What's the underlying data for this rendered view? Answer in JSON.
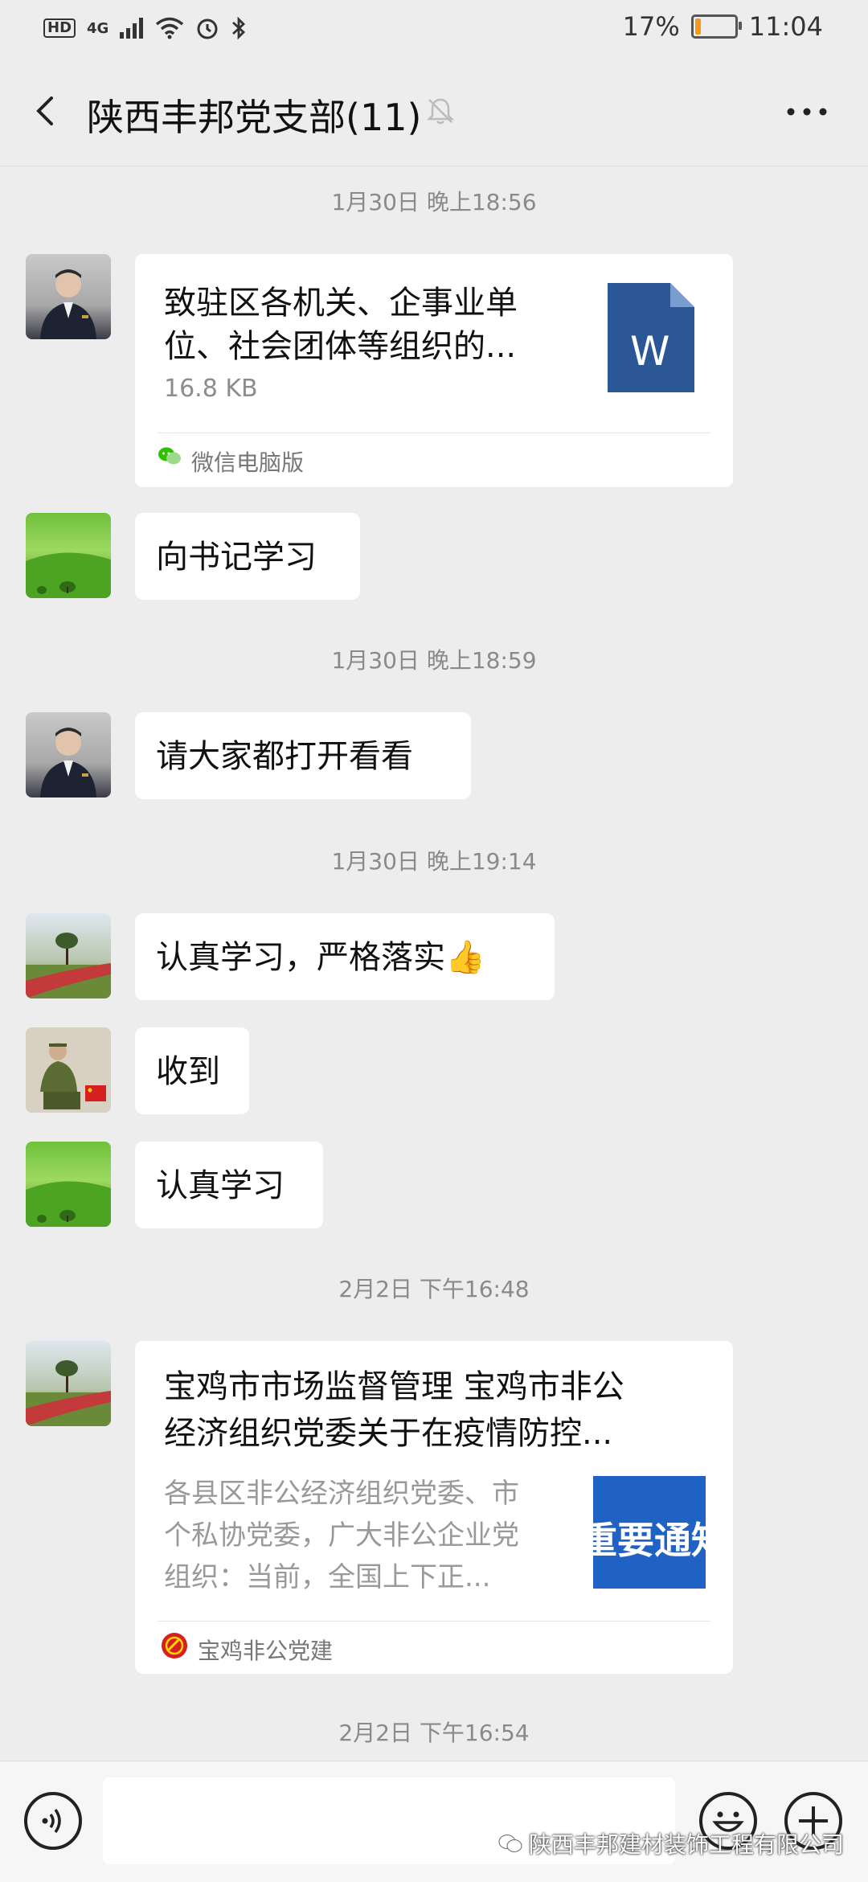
{
  "status_bar": {
    "hd": "HD",
    "network": "4G",
    "battery_percent": "17%",
    "battery_level": 0.17,
    "time": "11:04"
  },
  "header": {
    "title": "陕西丰邦党支部(11)",
    "back_icon": "chevron-left-icon",
    "mute_icon": "bell-off-icon",
    "more_icon": "more-dots-icon"
  },
  "messages": {
    "ts1": "1月30日 晚上18:56",
    "file_card": {
      "title_line1": "致驻区各机关、企事业单",
      "title_line2": "位、社会团体等组织的...",
      "size": "16.8 KB",
      "file_icon_letter": "W",
      "source": "微信电脑版"
    },
    "msg_study_secretary": "向书记学习",
    "ts2": "1月30日 晚上18:59",
    "msg_open_all": "请大家都打开看看",
    "ts3": "1月30日 晚上19:14",
    "msg_implement": "认真学习，严格落实",
    "thumbs_up": "👍",
    "msg_received": "收到",
    "msg_study": "认真学习",
    "ts4": "2月2日 下午16:48",
    "article_card": {
      "title_line1": "宝鸡市市场监督管理 宝鸡市非公",
      "title_line2": "经济组织党委关于在疫情防控...",
      "desc_line1": "各县区非公经济组织党委、市",
      "desc_line2": "个私协党委，广大非公企业党",
      "desc_line3": "组织：当前，全国上下正...",
      "thumb_text": "重要通知",
      "source": "宝鸡非公党建"
    },
    "ts5": "2月2日 下午16:54"
  },
  "input_bar": {
    "voice_icon": "voice-icon",
    "emoji_icon": "emoji-icon",
    "plus_icon": "plus-icon",
    "watermark": "陕西丰邦建材装饰工程有限公司"
  },
  "colors": {
    "background": "#ededed",
    "bubble": "#ffffff",
    "word_blue": "#2b5797",
    "battery_orange": "#f29a1a"
  }
}
